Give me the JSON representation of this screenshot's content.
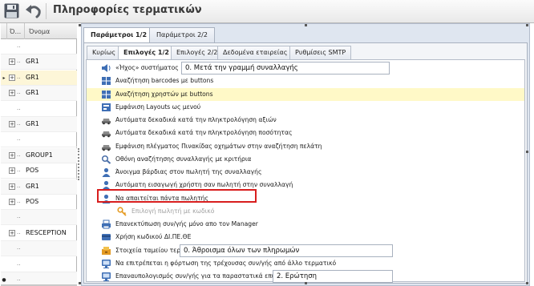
{
  "window": {
    "title": "Πληροφορίες τερματικών",
    "toolbar": [
      "save-icon",
      "undo-icon"
    ]
  },
  "grid": {
    "columns": [
      "Ό...",
      "Όνομα"
    ],
    "rows": [
      {
        "marker": "",
        "name": "",
        "expandable": false
      },
      {
        "marker": "",
        "name": "GR1",
        "expandable": true
      },
      {
        "marker": "▸",
        "name": "GR1",
        "expandable": true,
        "current": true
      },
      {
        "marker": "",
        "name": "GR1",
        "expandable": true
      },
      {
        "marker": "",
        "name": "",
        "expandable": false
      },
      {
        "marker": "",
        "name": "GR1",
        "expandable": true
      },
      {
        "marker": "",
        "name": "",
        "expandable": false
      },
      {
        "marker": "",
        "name": "GROUP1",
        "expandable": true
      },
      {
        "marker": "",
        "name": "POS",
        "expandable": true
      },
      {
        "marker": "",
        "name": "GR1",
        "expandable": true
      },
      {
        "marker": "",
        "name": "POS",
        "expandable": true
      },
      {
        "marker": "",
        "name": "",
        "expandable": false
      },
      {
        "marker": "",
        "name": "RESCEPTION",
        "expandable": true
      },
      {
        "marker": "",
        "name": "",
        "expandable": false
      },
      {
        "marker": "",
        "name": "",
        "expandable": false
      },
      {
        "marker": "●",
        "name": "",
        "expandable": false
      }
    ],
    "row_prefix": ".."
  },
  "outer_tabs": [
    {
      "label": "Παράμετροι 1/2",
      "active": true
    },
    {
      "label": "Παράμετροι 2/2",
      "active": false
    }
  ],
  "inner_tabs": [
    {
      "label": "Κυρίως",
      "active": false
    },
    {
      "label": "Επιλογές 1/2",
      "active": true
    },
    {
      "label": "Επιλογές 2/2",
      "active": false
    },
    {
      "label": "Δεδομένα εταιρείας",
      "active": false
    },
    {
      "label": "Ρυθμίσεις SMTP",
      "active": false
    }
  ],
  "options": [
    {
      "icon": "speaker-icon",
      "label": "«Ήχος» συστήματος",
      "field": "0. Μετά την γραμμή συναλλαγής"
    },
    {
      "icon": "grid-icon",
      "label": "Αναζήτηση barcodes με buttons"
    },
    {
      "icon": "grid-icon",
      "label": "Αναζήτηση χρηστών με buttons",
      "highlight": true
    },
    {
      "icon": "layout-icon",
      "label": "Εμφάνιση Layouts ως μενού"
    },
    {
      "icon": "car-icon",
      "label": "Αυτόματα δεκαδικά κατά την πληκτρολόγηση αξιών"
    },
    {
      "icon": "car-icon",
      "label": "Αυτόματα δεκαδικά κατά την πληκτρολόγηση ποσότητας"
    },
    {
      "icon": "car-icon",
      "label": "Εμφάνιση πλέγματος Πινακίδας οχημάτων στην αναζήτηση πελάτη"
    },
    {
      "icon": "search-icon",
      "label": "Οθόνη αναζήτησης συναλλαγής με κριτήρια",
      "annotated": true
    },
    {
      "icon": "user-icon",
      "label": "Άνοιγμα βάρδιας στον πωλητή της συναλλαγής"
    },
    {
      "icon": "user-icon",
      "label": "Αυτόματη εισαγωγή χρήστη σαν πωλητή στην συναλλαγή"
    },
    {
      "icon": "user-icon",
      "label": "Να απαιτείται πάντα πωλητής"
    },
    {
      "icon": "key-icon",
      "label": "Επιλογή πωλητή με κωδικό",
      "disabled": true,
      "indent": true
    },
    {
      "icon": "printer-icon",
      "label": "Επανεκτύπωση συν/γής μόνο απο τον Manager"
    },
    {
      "icon": "card-icon",
      "label": "Χρήση κωδικού ΔΙ.ΠΕ.ΘΕ"
    },
    {
      "icon": "cashbox-icon",
      "label": "Στοιχεία ταμείου τερματικού",
      "field": "0. Άθροισμα όλων των πληρωμών"
    },
    {
      "icon": "monitor-icon",
      "label": "Να επιτρέπεται η φόρτωση της τρέχουσας συν/γής από άλλο τερματικό"
    },
    {
      "icon": "monitor-icon",
      "label": "Επαναυπολογισμός συν/γής για τα παραστατικά επιστροφής",
      "field": "2. Ερώτηση"
    }
  ]
}
